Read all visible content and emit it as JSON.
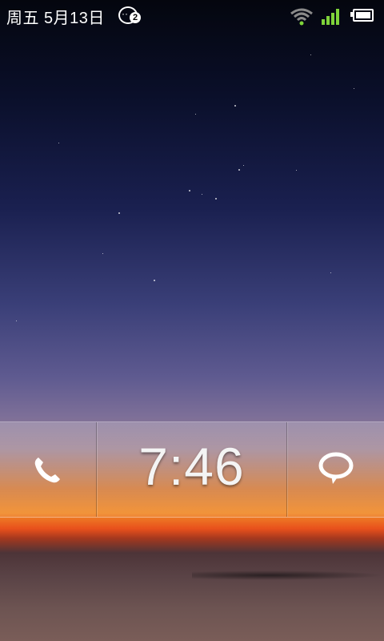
{
  "status": {
    "date": "周五 5月13日",
    "notification_count": "2",
    "wifi_icon": "wifi-icon",
    "signal_icon": "signal-icon",
    "battery_icon": "battery-icon",
    "signal_color": "#7fd33a"
  },
  "lockscreen": {
    "time": "7:46",
    "left_icon": "phone-icon",
    "right_icon": "message-icon"
  }
}
